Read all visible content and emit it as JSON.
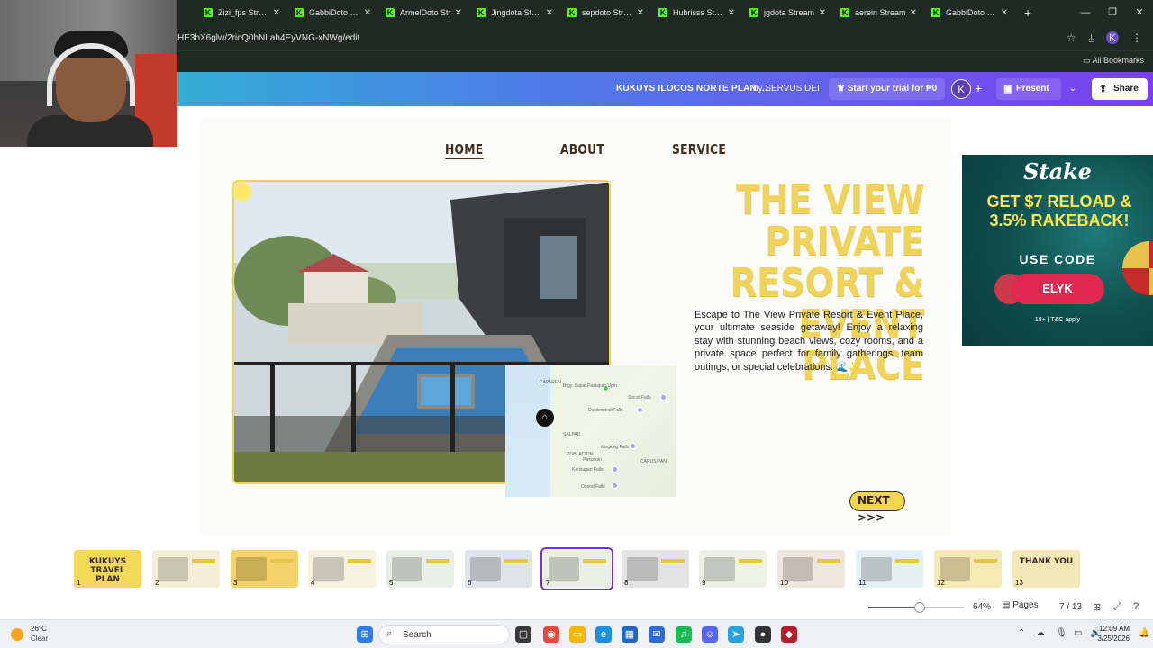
{
  "browser": {
    "tabs": [
      {
        "label": "Zizi_fps Stream"
      },
      {
        "label": "GabbiDoto Str"
      },
      {
        "label": "ArmelDoto Str"
      },
      {
        "label": "Jingdota Stream"
      },
      {
        "label": "sepdoto Stream"
      },
      {
        "label": "Hubrisss Stream"
      },
      {
        "label": "jgdota Stream"
      },
      {
        "label": "aerein Stream"
      },
      {
        "label": "GabbiDoto Str"
      }
    ],
    "new_tab_icon": "+",
    "url": "HE3hX6glw/2ricQ0hNLah4EyVNG-xNWg/edit",
    "all_bookmarks": "All Bookmarks",
    "profile_initial": "K"
  },
  "canva": {
    "doc_title": "KUKUYS ILOCOS NORTE PLANI...",
    "doc_by": "by SERVUS DEI",
    "trial_button": "Start your trial for ₱0",
    "collaborator_initial": "K",
    "present_label": "Present",
    "share_label": "Share"
  },
  "slide": {
    "nav": [
      "HOME",
      "ABOUT",
      "SERVICE"
    ],
    "headline": "THE VIEW PRIVATE RESORT & EVENT PLACE",
    "description": "Escape to The View Private Resort & Event Place, your ultimate seaside getaway! Enjoy a relaxing stay with stunning beach views, cozy rooms, and a private space perfect for family gatherings, team outings, or special celebrations. 🌊✨",
    "next_label": "NEXT >>>",
    "accent_color": "#f0d35a",
    "map_labels": {
      "pasuquin": "Pasuquin",
      "brgy": "Brgy. Sapat Pasuquin Upm",
      "sincol": "Sincol Falls",
      "dordorwindi": "Dordorwindi Falls",
      "kingking": "Kingking Falls",
      "karisugan": "Karisugan Falls",
      "ozeod": "Ozeod Falls",
      "salpad": "SALPAD",
      "carusipan": "CARUSIPAN",
      "caparen": "CAPAREN",
      "poblacion": "POBLACION"
    }
  },
  "ad": {
    "brand": "Stake",
    "offer": "GET $7 RELOAD & 3.5% RAKEBACK!",
    "use_code": "USE CODE",
    "code": "ELYK",
    "terms": "18+ | T&C apply"
  },
  "pages": {
    "thumbnails": [
      {
        "num": "1",
        "color": "#f5d85a",
        "caption": "KUKUYS TRAVEL PLAN"
      },
      {
        "num": "2",
        "color": "#f6efd8",
        "caption": ""
      },
      {
        "num": "3",
        "color": "#f4d36a",
        "caption": ""
      },
      {
        "num": "4",
        "color": "#f7f1df",
        "caption": ""
      },
      {
        "num": "5",
        "color": "#e8efe6",
        "caption": ""
      },
      {
        "num": "6",
        "color": "#dfe3ea",
        "caption": ""
      },
      {
        "num": "7",
        "color": "#e9efe3",
        "caption": ""
      },
      {
        "num": "8",
        "color": "#e3e3e3",
        "caption": ""
      },
      {
        "num": "9",
        "color": "#eef2e6",
        "caption": ""
      },
      {
        "num": "10",
        "color": "#efe6dc",
        "caption": ""
      },
      {
        "num": "11",
        "color": "#e3f0f4",
        "caption": ""
      },
      {
        "num": "12",
        "color": "#f6e9b4",
        "caption": ""
      },
      {
        "num": "13",
        "color": "#f3e7b8",
        "caption": "THANK YOU"
      }
    ],
    "active_page": 7,
    "zoom": "64%",
    "zoom_level": 0.64,
    "pages_label": "Pages",
    "page_count": "7 / 13"
  },
  "taskbar": {
    "temperature": "26°C",
    "condition": "Clear",
    "search_label": "Search",
    "time": "12:09 AM",
    "date": "3/25/2026"
  }
}
